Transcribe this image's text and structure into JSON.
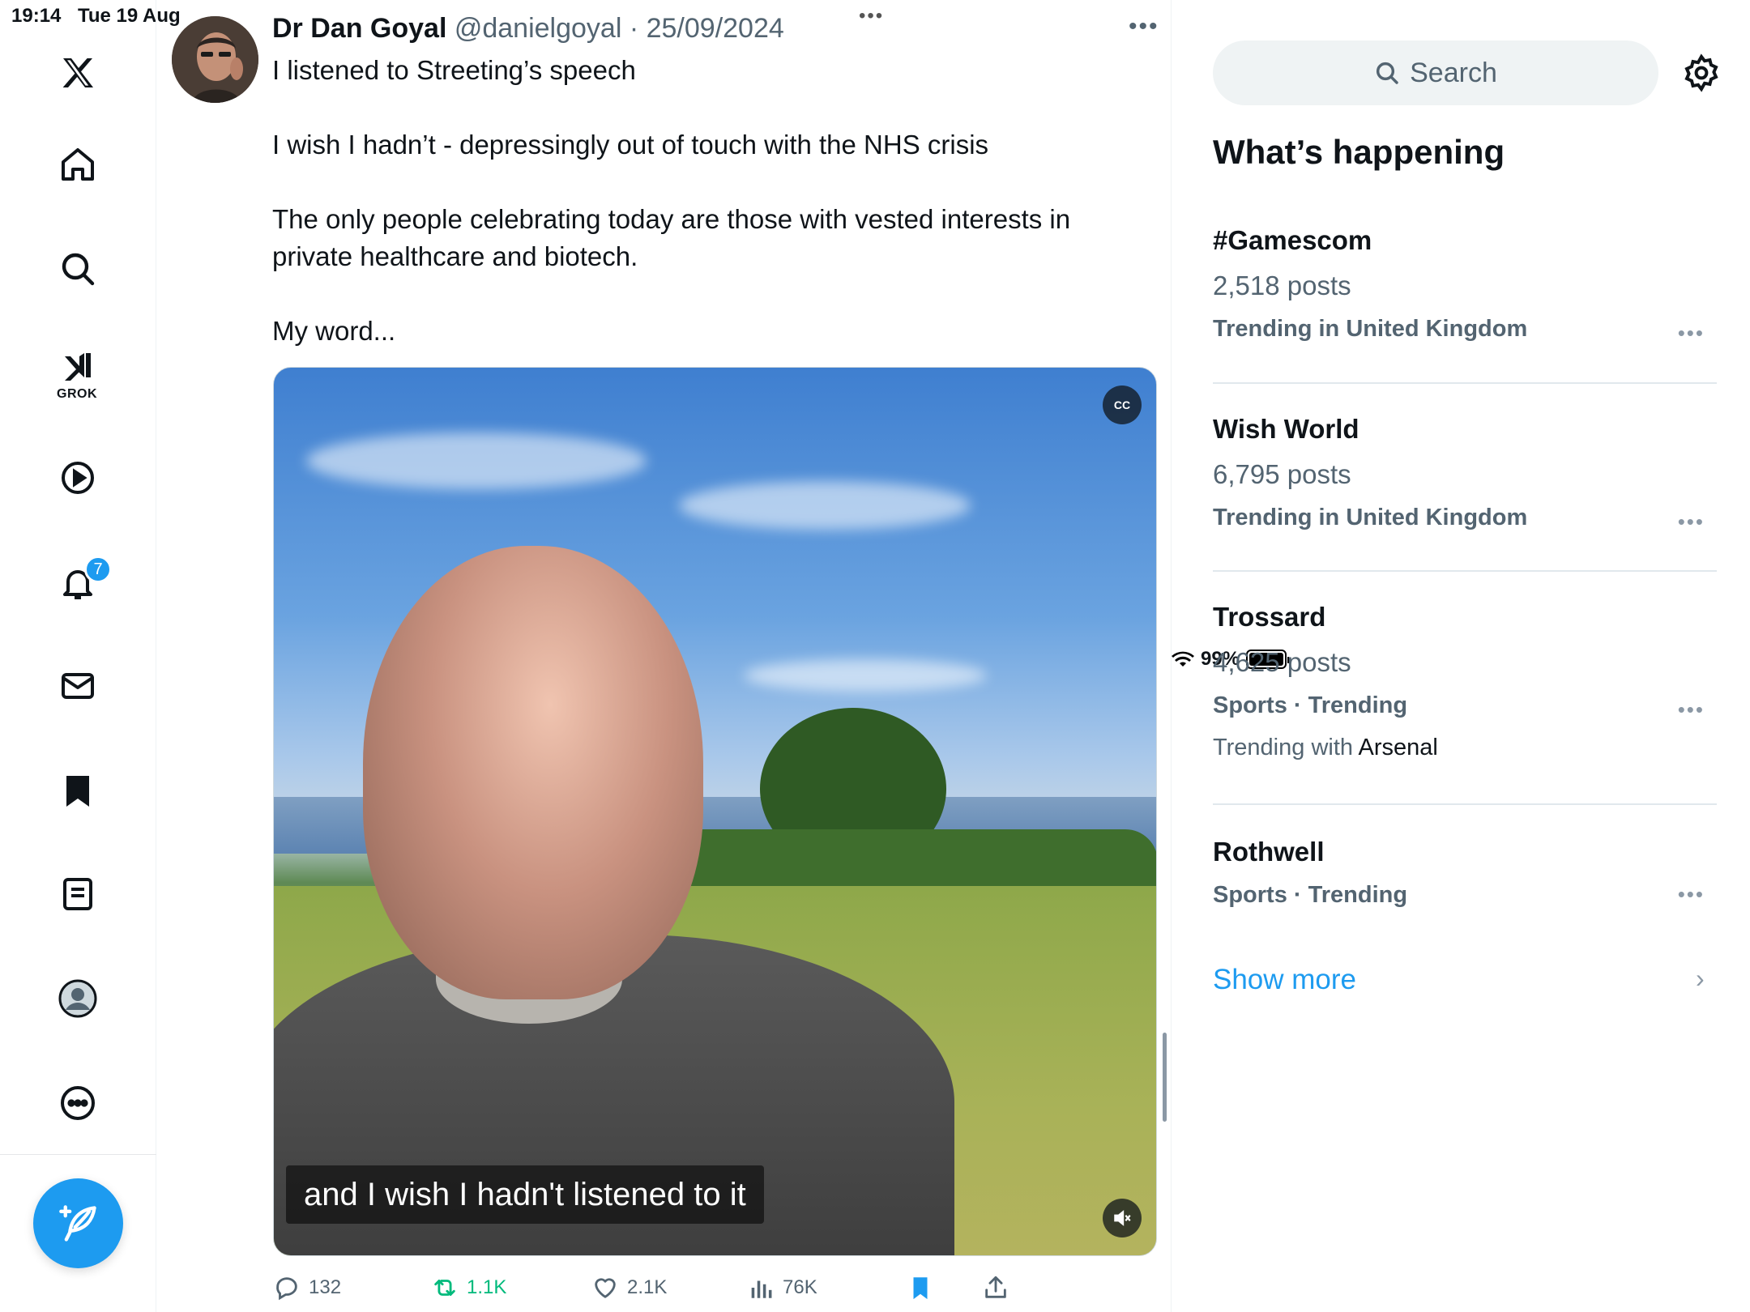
{
  "status_bar": {
    "time": "19:14",
    "date": "Tue 19 Aug",
    "battery": "99%",
    "multitask_dots": "•••"
  },
  "nav": {
    "grok_label": "GROK",
    "notifications_badge": "7"
  },
  "tweet": {
    "author_name": "Dr Dan Goyal",
    "author_handle": "@danielgoyal",
    "date": "· 25/09/2024",
    "more": "•••",
    "paragraphs": [
      "I listened to Streeting’s speech",
      "I wish I hadn’t - depressingly out of touch with the NHS crisis",
      "The only people celebrating today are those with vested interests in private healthcare and biotech.",
      "My word..."
    ],
    "video": {
      "caption": "and I wish I hadn't listened to it",
      "cc_label": "CC"
    },
    "actions": {
      "replies": "132",
      "reposts": "1.1K",
      "likes": "2.1K",
      "views": "76K"
    }
  },
  "sidebar": {
    "search_placeholder": "Search",
    "title": "What’s happening",
    "trends": [
      {
        "name": "#Gamescom",
        "posts": "2,518 posts",
        "context": "Trending in United Kingdom"
      },
      {
        "name": "Wish World",
        "posts": "6,795 posts",
        "context": "Trending in United Kingdom"
      },
      {
        "name": "Trossard",
        "posts": "4,625 posts",
        "context": "Sports · Trending",
        "with_label": "Trending with",
        "with_value": "Arsenal"
      },
      {
        "name": "Rothwell",
        "posts": "",
        "context": "Sports · Trending"
      }
    ],
    "trend_more": "•••",
    "show_more": "Show more",
    "show_more_chevron": "›"
  },
  "colors": {
    "accent": "#1d9bf0",
    "repost": "#00ba7c",
    "muted": "#536471"
  }
}
